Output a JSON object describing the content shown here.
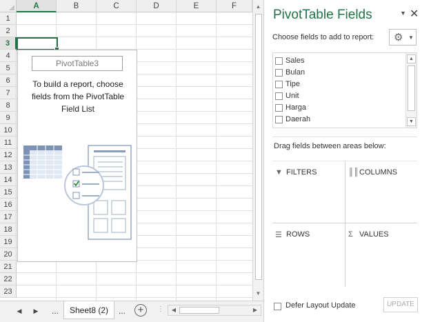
{
  "spreadsheet": {
    "columns": [
      "A",
      "B",
      "C",
      "D",
      "E",
      "F"
    ],
    "active_column": "A",
    "rows": [
      "1",
      "2",
      "3",
      "4",
      "5",
      "6",
      "7",
      "8",
      "9",
      "10",
      "11",
      "12",
      "13",
      "14",
      "15",
      "16",
      "17",
      "18",
      "19",
      "20",
      "21",
      "22",
      "23"
    ],
    "active_row": "3",
    "pivot_placeholder": {
      "name": "PivotTable3",
      "message": "To build a report, choose fields from the PivotTable Field List"
    },
    "colors": {
      "accent": "#217346",
      "grid_line": "#e0e0e0",
      "header_bg": "#efefef"
    }
  },
  "sheet_bar": {
    "prev_icon": "triangle-left-icon",
    "next_icon": "triangle-right-icon",
    "more_left": "...",
    "active_sheet": "Sheet8 (2)",
    "more_right": "...",
    "add_icon": "plus-circle-icon"
  },
  "pivot_pane": {
    "title": "PivotTable Fields",
    "choose_label": "Choose fields to add to report:",
    "fields": [
      "Sales",
      "Bulan",
      "Tipe",
      "Unit",
      "Harga",
      "Daerah"
    ],
    "drag_label": "Drag fields between areas below:",
    "areas": {
      "filters": "FILTERS",
      "columns": "COLUMNS",
      "rows": "ROWS",
      "values": "VALUES"
    },
    "defer_label": "Defer Layout Update",
    "update_label": "UPDATE",
    "title_color": "#217346"
  }
}
